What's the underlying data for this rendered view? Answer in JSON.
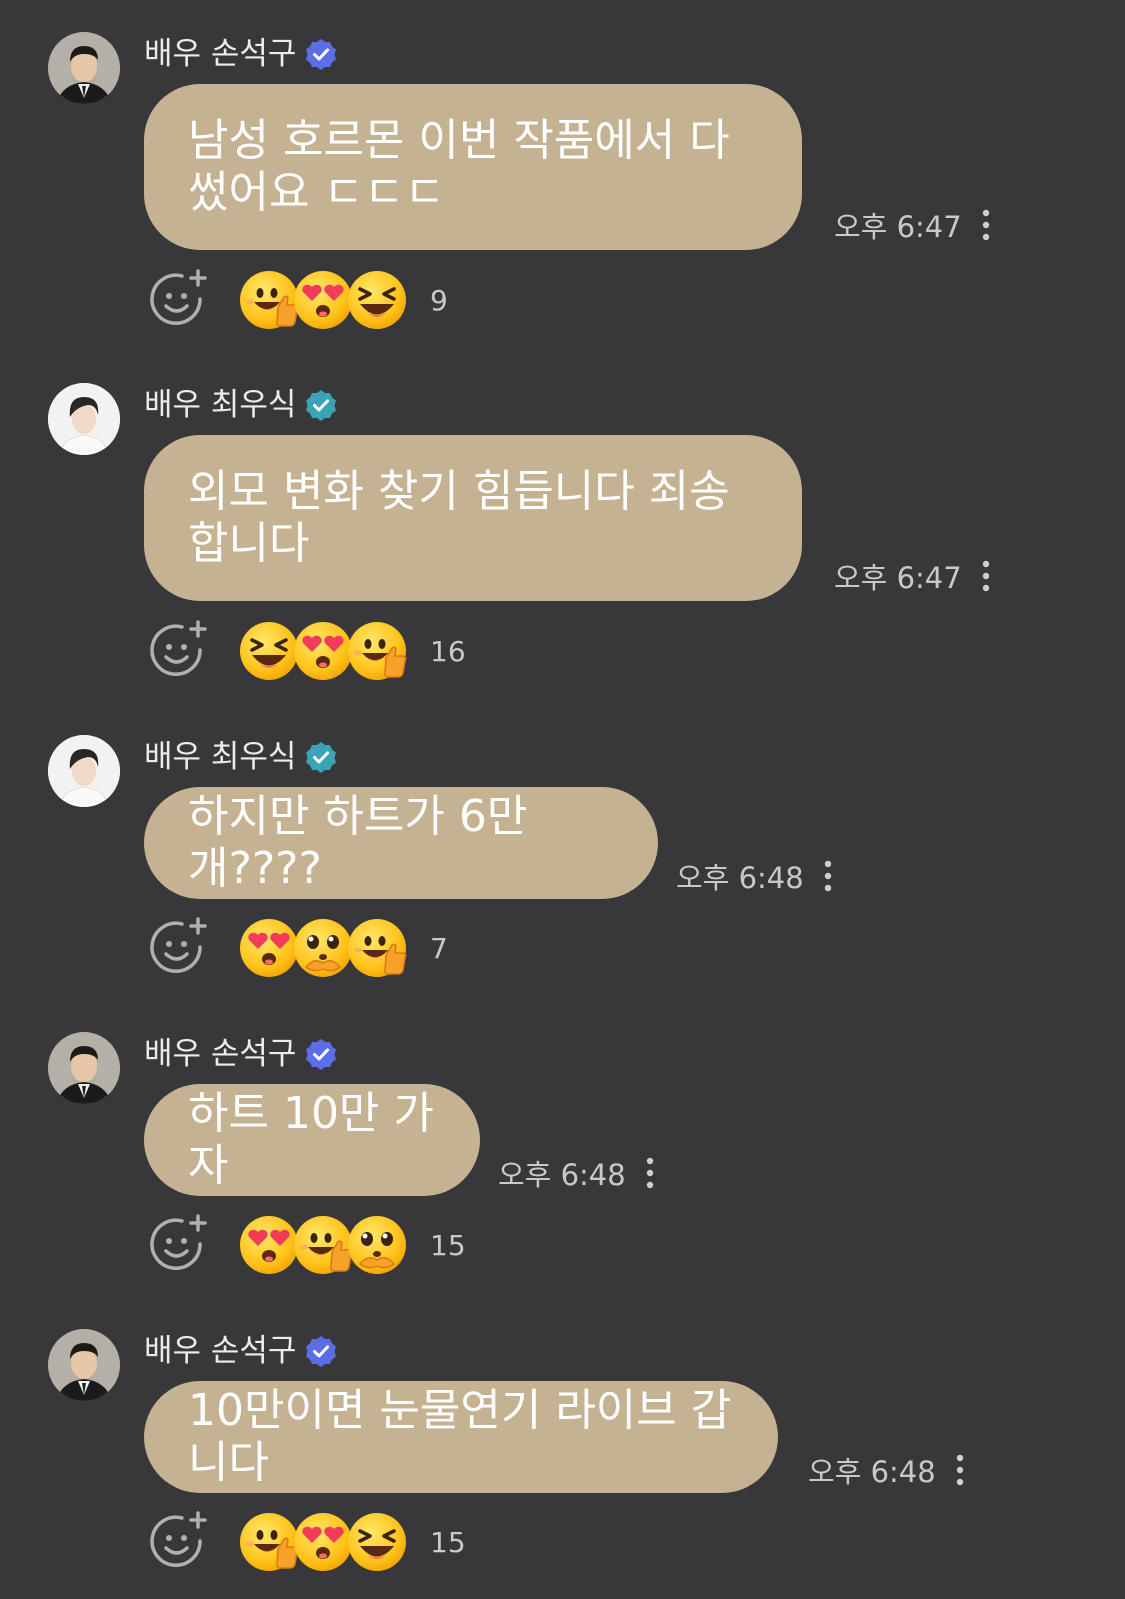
{
  "messages": [
    {
      "sender": "배우 손석구",
      "avatar": "actor-son-avatar",
      "badge_color": "#5b6ee8",
      "text": "남성 호르몬 이번 작품에서 다 썼어요 ㄷㄷㄷ",
      "time": "오후 6:47",
      "reactions": [
        "thumbs-up-face",
        "heart-eyes-face",
        "laughing-face"
      ],
      "reaction_count": "9"
    },
    {
      "sender": "배우 최우식",
      "avatar": "actor-choi-avatar",
      "badge_color": "#3aa3b5",
      "text": "외모 변화 찾기 힘듭니다 죄송합니다",
      "time": "오후 6:47",
      "reactions": [
        "laughing-face",
        "heart-eyes-face",
        "thumbs-up-face"
      ],
      "reaction_count": "16"
    },
    {
      "sender": "배우 최우식",
      "avatar": "actor-choi-avatar",
      "badge_color": "#3aa3b5",
      "text": "하지만 하트가 6만개????",
      "time": "오후 6:48",
      "reactions": [
        "heart-eyes-face",
        "pleading-face",
        "thumbs-up-face"
      ],
      "reaction_count": "7"
    },
    {
      "sender": "배우 손석구",
      "avatar": "actor-son-avatar",
      "badge_color": "#5b6ee8",
      "text": "하트 10만 가자",
      "time": "오후 6:48",
      "reactions": [
        "heart-eyes-face",
        "thumbs-up-face",
        "pleading-face"
      ],
      "reaction_count": "15"
    },
    {
      "sender": "배우 손석구",
      "avatar": "actor-son-avatar",
      "badge_color": "#5b6ee8",
      "text": "10만이면 눈물연기 라이브 갑니다",
      "time": "오후 6:48",
      "reactions": [
        "thumbs-up-face",
        "heart-eyes-face",
        "laughing-face"
      ],
      "reaction_count": "15"
    }
  ]
}
